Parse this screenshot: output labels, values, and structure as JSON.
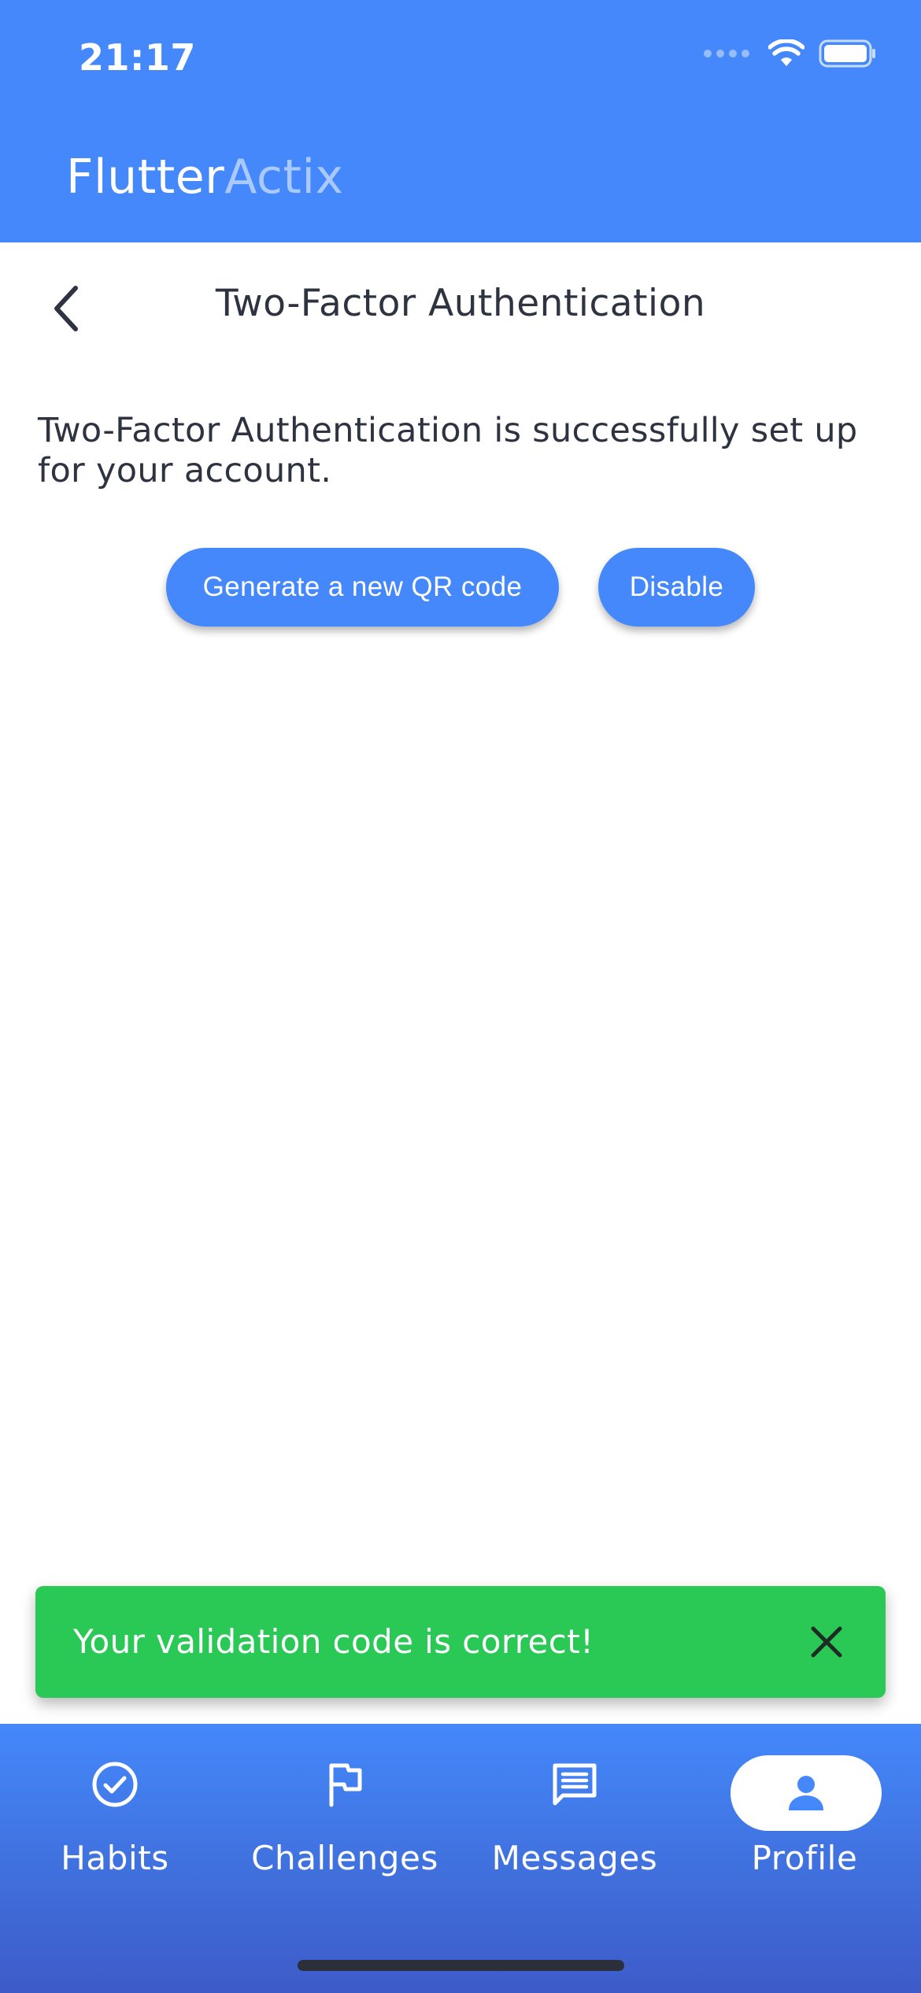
{
  "status_bar": {
    "time": "21:17"
  },
  "app": {
    "brand_primary": "Flutter",
    "brand_secondary": "Actix"
  },
  "page": {
    "title": "Two-Factor Authentication"
  },
  "content": {
    "message": "Two-Factor Authentication is successfully set up for your account.",
    "generate_button": "Generate a new QR code",
    "disable_button": "Disable"
  },
  "snackbar": {
    "text": "Your validation code is correct!"
  },
  "nav": {
    "items": [
      {
        "label": "Habits",
        "icon": "check-circle-icon"
      },
      {
        "label": "Challenges",
        "icon": "flag-icon"
      },
      {
        "label": "Messages",
        "icon": "message-icon"
      },
      {
        "label": "Profile",
        "icon": "person-icon",
        "active": true
      }
    ]
  },
  "colors": {
    "primary": "#4488fb",
    "success": "#2ac854",
    "text": "#2d3340",
    "brand_accent": "#a9c9ff"
  }
}
